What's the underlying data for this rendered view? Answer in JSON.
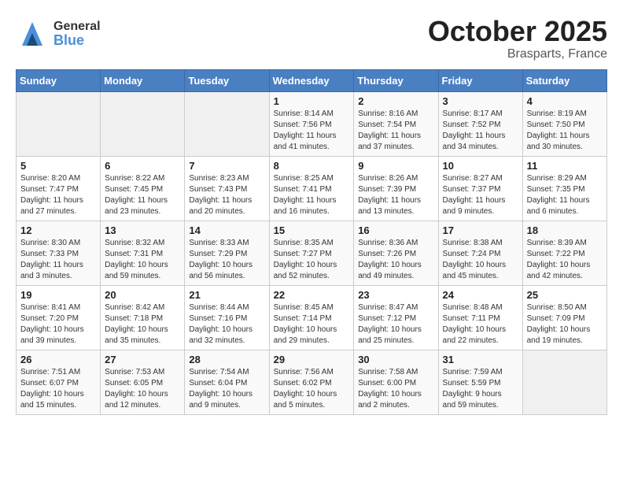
{
  "header": {
    "logo_general": "General",
    "logo_blue": "Blue",
    "month": "October 2025",
    "location": "Brasparts, France"
  },
  "weekdays": [
    "Sunday",
    "Monday",
    "Tuesday",
    "Wednesday",
    "Thursday",
    "Friday",
    "Saturday"
  ],
  "weeks": [
    [
      {
        "day": "",
        "info": ""
      },
      {
        "day": "",
        "info": ""
      },
      {
        "day": "",
        "info": ""
      },
      {
        "day": "1",
        "info": "Sunrise: 8:14 AM\nSunset: 7:56 PM\nDaylight: 11 hours\nand 41 minutes."
      },
      {
        "day": "2",
        "info": "Sunrise: 8:16 AM\nSunset: 7:54 PM\nDaylight: 11 hours\nand 37 minutes."
      },
      {
        "day": "3",
        "info": "Sunrise: 8:17 AM\nSunset: 7:52 PM\nDaylight: 11 hours\nand 34 minutes."
      },
      {
        "day": "4",
        "info": "Sunrise: 8:19 AM\nSunset: 7:50 PM\nDaylight: 11 hours\nand 30 minutes."
      }
    ],
    [
      {
        "day": "5",
        "info": "Sunrise: 8:20 AM\nSunset: 7:47 PM\nDaylight: 11 hours\nand 27 minutes."
      },
      {
        "day": "6",
        "info": "Sunrise: 8:22 AM\nSunset: 7:45 PM\nDaylight: 11 hours\nand 23 minutes."
      },
      {
        "day": "7",
        "info": "Sunrise: 8:23 AM\nSunset: 7:43 PM\nDaylight: 11 hours\nand 20 minutes."
      },
      {
        "day": "8",
        "info": "Sunrise: 8:25 AM\nSunset: 7:41 PM\nDaylight: 11 hours\nand 16 minutes."
      },
      {
        "day": "9",
        "info": "Sunrise: 8:26 AM\nSunset: 7:39 PM\nDaylight: 11 hours\nand 13 minutes."
      },
      {
        "day": "10",
        "info": "Sunrise: 8:27 AM\nSunset: 7:37 PM\nDaylight: 11 hours\nand 9 minutes."
      },
      {
        "day": "11",
        "info": "Sunrise: 8:29 AM\nSunset: 7:35 PM\nDaylight: 11 hours\nand 6 minutes."
      }
    ],
    [
      {
        "day": "12",
        "info": "Sunrise: 8:30 AM\nSunset: 7:33 PM\nDaylight: 11 hours\nand 3 minutes."
      },
      {
        "day": "13",
        "info": "Sunrise: 8:32 AM\nSunset: 7:31 PM\nDaylight: 10 hours\nand 59 minutes."
      },
      {
        "day": "14",
        "info": "Sunrise: 8:33 AM\nSunset: 7:29 PM\nDaylight: 10 hours\nand 56 minutes."
      },
      {
        "day": "15",
        "info": "Sunrise: 8:35 AM\nSunset: 7:27 PM\nDaylight: 10 hours\nand 52 minutes."
      },
      {
        "day": "16",
        "info": "Sunrise: 8:36 AM\nSunset: 7:26 PM\nDaylight: 10 hours\nand 49 minutes."
      },
      {
        "day": "17",
        "info": "Sunrise: 8:38 AM\nSunset: 7:24 PM\nDaylight: 10 hours\nand 45 minutes."
      },
      {
        "day": "18",
        "info": "Sunrise: 8:39 AM\nSunset: 7:22 PM\nDaylight: 10 hours\nand 42 minutes."
      }
    ],
    [
      {
        "day": "19",
        "info": "Sunrise: 8:41 AM\nSunset: 7:20 PM\nDaylight: 10 hours\nand 39 minutes."
      },
      {
        "day": "20",
        "info": "Sunrise: 8:42 AM\nSunset: 7:18 PM\nDaylight: 10 hours\nand 35 minutes."
      },
      {
        "day": "21",
        "info": "Sunrise: 8:44 AM\nSunset: 7:16 PM\nDaylight: 10 hours\nand 32 minutes."
      },
      {
        "day": "22",
        "info": "Sunrise: 8:45 AM\nSunset: 7:14 PM\nDaylight: 10 hours\nand 29 minutes."
      },
      {
        "day": "23",
        "info": "Sunrise: 8:47 AM\nSunset: 7:12 PM\nDaylight: 10 hours\nand 25 minutes."
      },
      {
        "day": "24",
        "info": "Sunrise: 8:48 AM\nSunset: 7:11 PM\nDaylight: 10 hours\nand 22 minutes."
      },
      {
        "day": "25",
        "info": "Sunrise: 8:50 AM\nSunset: 7:09 PM\nDaylight: 10 hours\nand 19 minutes."
      }
    ],
    [
      {
        "day": "26",
        "info": "Sunrise: 7:51 AM\nSunset: 6:07 PM\nDaylight: 10 hours\nand 15 minutes."
      },
      {
        "day": "27",
        "info": "Sunrise: 7:53 AM\nSunset: 6:05 PM\nDaylight: 10 hours\nand 12 minutes."
      },
      {
        "day": "28",
        "info": "Sunrise: 7:54 AM\nSunset: 6:04 PM\nDaylight: 10 hours\nand 9 minutes."
      },
      {
        "day": "29",
        "info": "Sunrise: 7:56 AM\nSunset: 6:02 PM\nDaylight: 10 hours\nand 5 minutes."
      },
      {
        "day": "30",
        "info": "Sunrise: 7:58 AM\nSunset: 6:00 PM\nDaylight: 10 hours\nand 2 minutes."
      },
      {
        "day": "31",
        "info": "Sunrise: 7:59 AM\nSunset: 5:59 PM\nDaylight: 9 hours\nand 59 minutes."
      },
      {
        "day": "",
        "info": ""
      }
    ]
  ]
}
